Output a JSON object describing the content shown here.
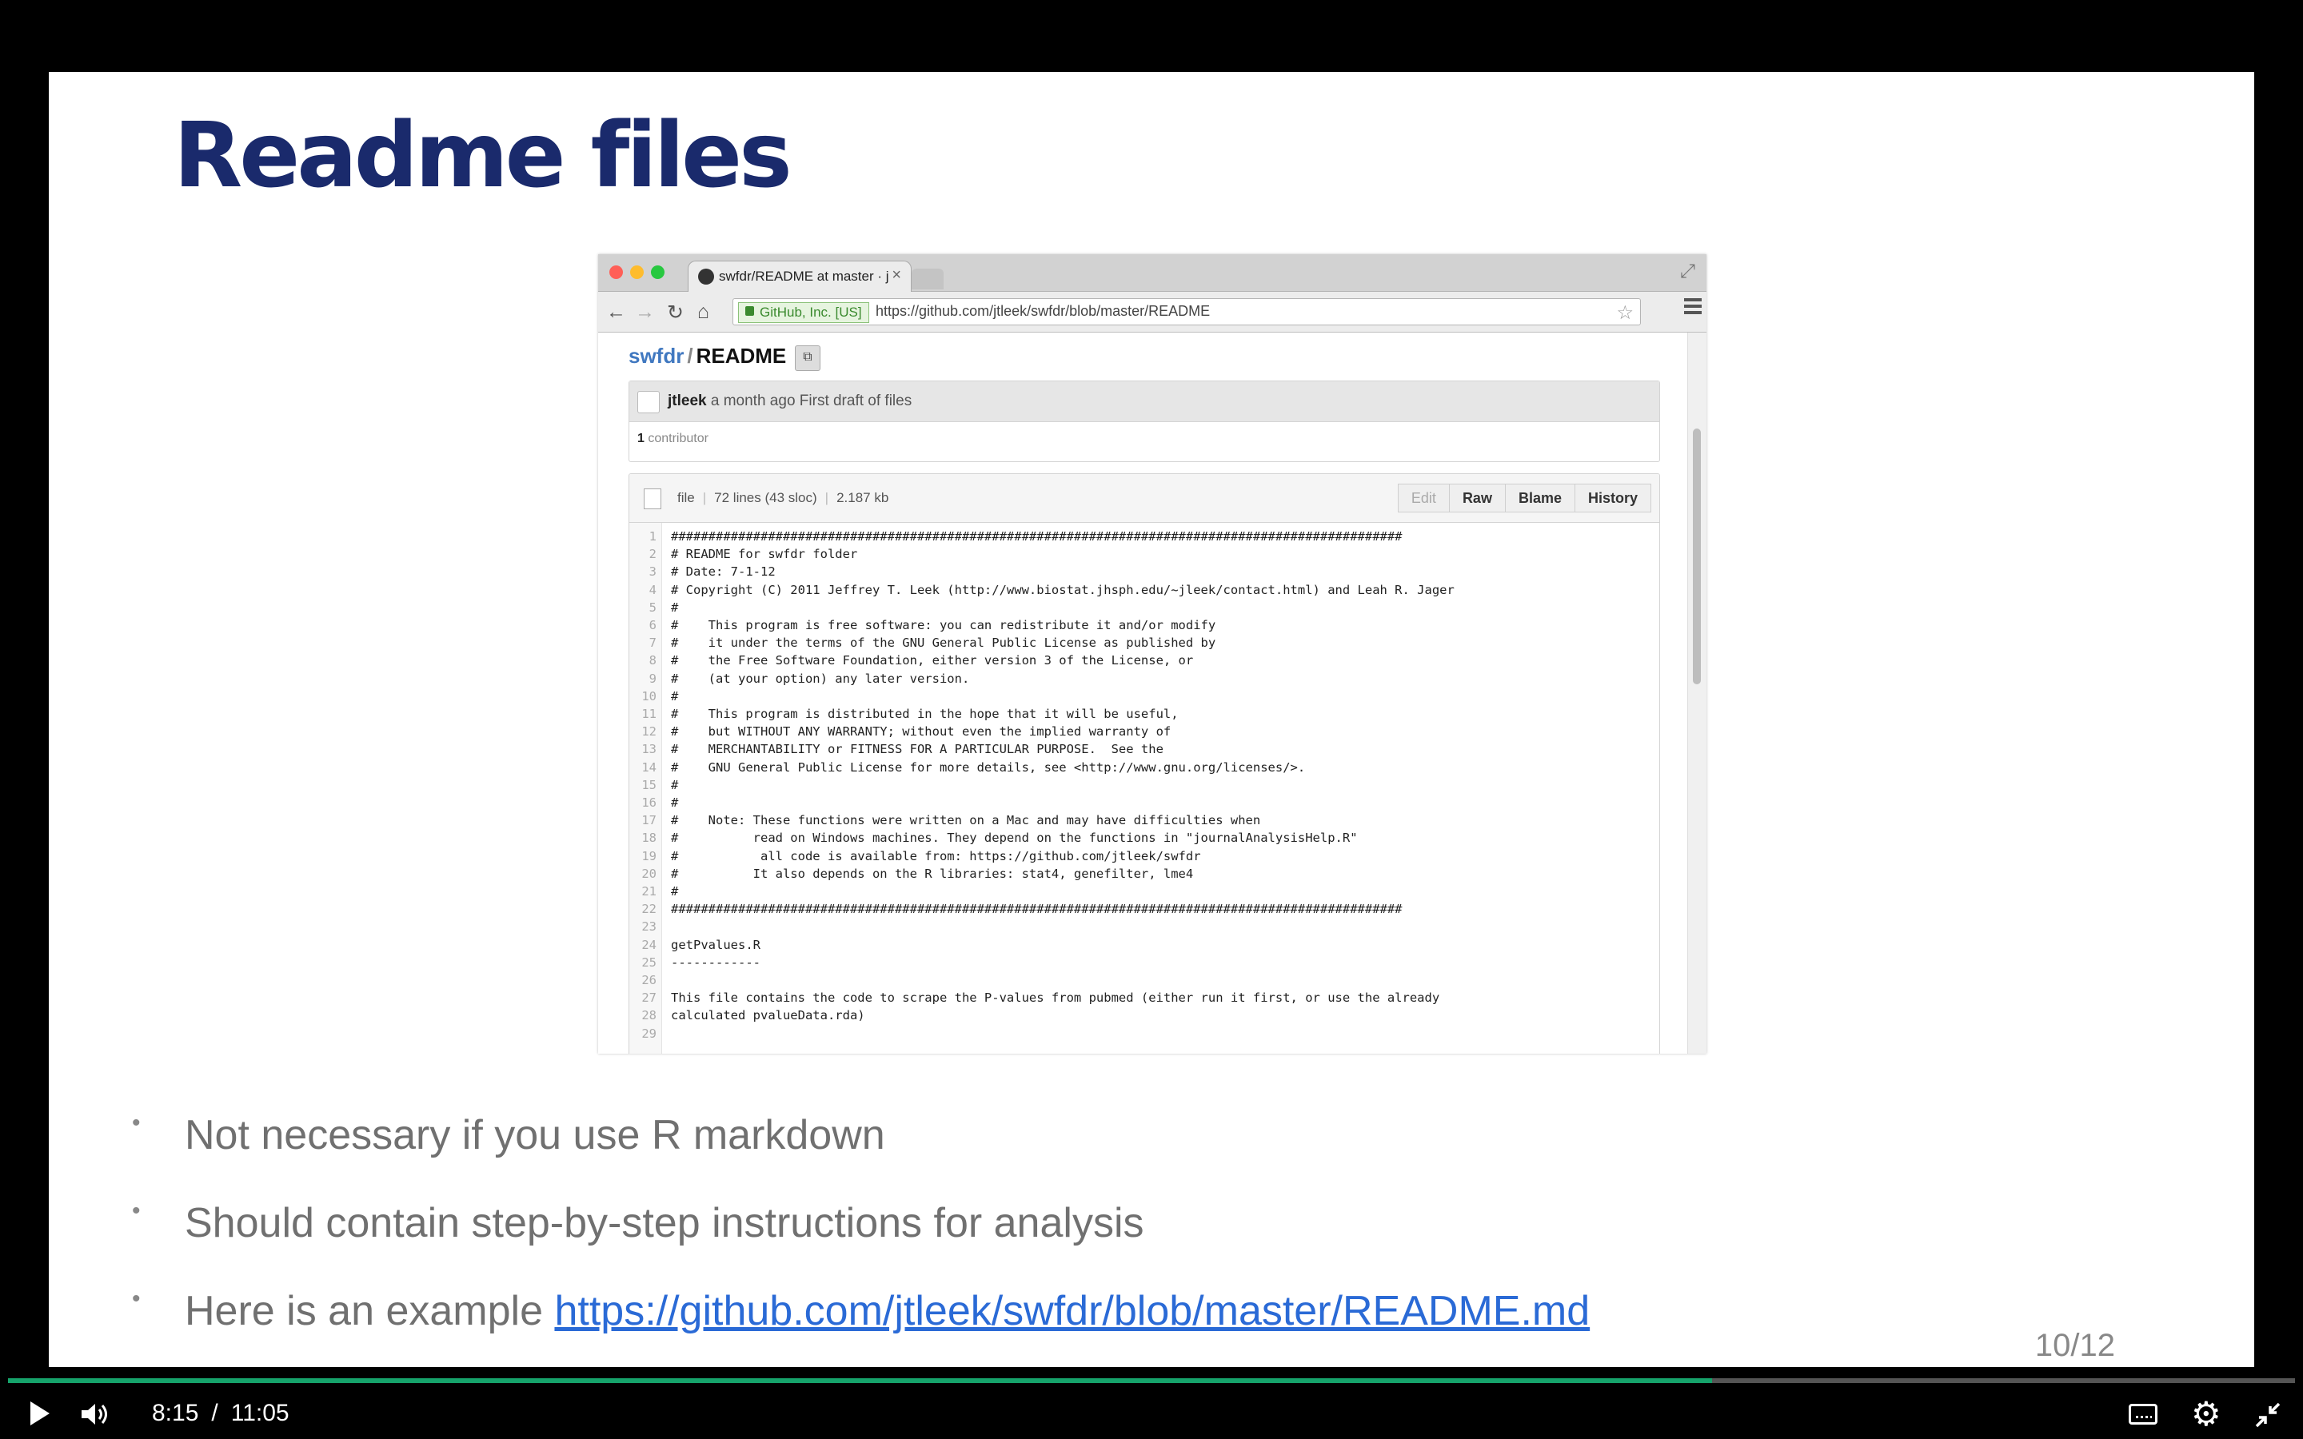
{
  "slide": {
    "title": "Readme files",
    "bullets": [
      {
        "text": "Not necessary if you use R markdown",
        "link": ""
      },
      {
        "text": "Should contain step-by-step instructions for analysis",
        "link": ""
      },
      {
        "text": "Here is an example ",
        "link": "https://github.com/jtleek/swfdr/blob/master/README.md"
      }
    ],
    "bullet_char": "•",
    "page_number": "10/12"
  },
  "browser": {
    "tab_title": "swfdr/README at master · j",
    "tab_close": "×",
    "nav": {
      "back": "←",
      "forward": "→",
      "reload": "↻",
      "home": "⌂"
    },
    "secure_label": "GitHub, Inc. [US]",
    "url": "https://github.com/jtleek/swfdr/blob/master/README",
    "star": "☆",
    "fullscreen": "⤢"
  },
  "github": {
    "repo": "swfdr",
    "separator": "/",
    "file": "README",
    "clipboard_icon": "⧉",
    "commit": {
      "author": "jtleek",
      "message": " a month ago First draft of files"
    },
    "contributors": {
      "count": "1",
      "label": " contributor"
    },
    "file_meta": {
      "type": "file",
      "lines": "72 lines (43 sloc)",
      "size": "2.187 kb"
    },
    "buttons": {
      "edit": "Edit",
      "raw": "Raw",
      "blame": "Blame",
      "history": "History"
    },
    "code_lines": [
      {
        "n": "1",
        "t": "##################################################################################################"
      },
      {
        "n": "2",
        "t": "# README for swfdr folder"
      },
      {
        "n": "3",
        "t": "# Date: 7-1-12"
      },
      {
        "n": "4",
        "t": "# Copyright (C) 2011 Jeffrey T. Leek (http://www.biostat.jhsph.edu/~jleek/contact.html) and Leah R. Jager"
      },
      {
        "n": "5",
        "t": "#"
      },
      {
        "n": "6",
        "t": "#    This program is free software: you can redistribute it and/or modify"
      },
      {
        "n": "7",
        "t": "#    it under the terms of the GNU General Public License as published by"
      },
      {
        "n": "8",
        "t": "#    the Free Software Foundation, either version 3 of the License, or"
      },
      {
        "n": "9",
        "t": "#    (at your option) any later version."
      },
      {
        "n": "10",
        "t": "#"
      },
      {
        "n": "11",
        "t": "#    This program is distributed in the hope that it will be useful,"
      },
      {
        "n": "12",
        "t": "#    but WITHOUT ANY WARRANTY; without even the implied warranty of"
      },
      {
        "n": "13",
        "t": "#    MERCHANTABILITY or FITNESS FOR A PARTICULAR PURPOSE.  See the"
      },
      {
        "n": "14",
        "t": "#    GNU General Public License for more details, see <http://www.gnu.org/licenses/>."
      },
      {
        "n": "15",
        "t": "#"
      },
      {
        "n": "16",
        "t": "#"
      },
      {
        "n": "17",
        "t": "#    Note: These functions were written on a Mac and may have difficulties when"
      },
      {
        "n": "18",
        "t": "#          read on Windows machines. They depend on the functions in \"journalAnalysisHelp.R\""
      },
      {
        "n": "19",
        "t": "#           all code is available from: https://github.com/jtleek/swfdr"
      },
      {
        "n": "20",
        "t": "#          It also depends on the R libraries: stat4, genefilter, lme4"
      },
      {
        "n": "21",
        "t": "#"
      },
      {
        "n": "22",
        "t": "##################################################################################################"
      },
      {
        "n": "23",
        "t": ""
      },
      {
        "n": "24",
        "t": "getPvalues.R"
      },
      {
        "n": "25",
        "t": "------------"
      },
      {
        "n": "26",
        "t": ""
      },
      {
        "n": "27",
        "t": "This file contains the code to scrape the P-values from pubmed (either run it first, or use the already"
      },
      {
        "n": "28",
        "t": "calculated pvalueData.rda)"
      },
      {
        "n": "29",
        "t": ""
      }
    ]
  },
  "player": {
    "current_time": "8:15",
    "time_separator": "/",
    "duration": "11:05",
    "progress_fraction": 0.745,
    "gear": "⚙",
    "colors": {
      "progress": "#16a36b"
    }
  },
  "colors": {
    "title": "#1a2a6c",
    "link": "#2a6ad6",
    "repo_link": "#4078c0",
    "traffic_lights": [
      "#ff5f57",
      "#febc2e",
      "#28c840"
    ]
  }
}
